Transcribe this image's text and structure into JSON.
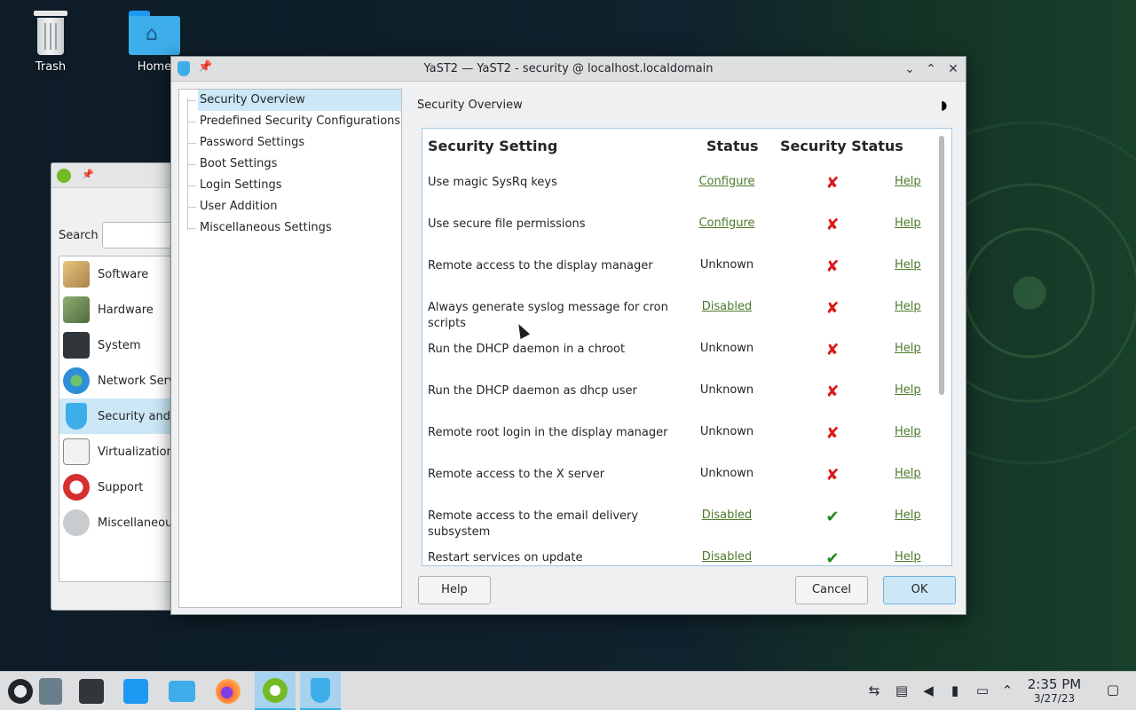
{
  "desktop": {
    "icons": [
      {
        "label": "Trash"
      },
      {
        "label": "Home"
      }
    ]
  },
  "back_window": {
    "search_label": "Search",
    "categories": [
      {
        "label": "Software",
        "color": "#c9a764"
      },
      {
        "label": "Hardware",
        "color": "#6f8a5a"
      },
      {
        "label": "System",
        "color": "#31363b"
      },
      {
        "label": "Network Serv",
        "color": "#2e8fd6"
      },
      {
        "label": "Security and U",
        "color": "#3daee9"
      },
      {
        "label": "Virtualization",
        "color": "#e8e8e8"
      },
      {
        "label": "Support",
        "color": "#d62f2f"
      },
      {
        "label": "Miscellaneous",
        "color": "#c9cccf"
      }
    ]
  },
  "window": {
    "title": "YaST2 — YaST2 - security @ localhost.localdomain",
    "tree": [
      {
        "label": "Security Overview"
      },
      {
        "label": "Predefined Security Configurations"
      },
      {
        "label": "Password Settings"
      },
      {
        "label": "Boot Settings"
      },
      {
        "label": "Login Settings"
      },
      {
        "label": "User Addition"
      },
      {
        "label": "Miscellaneous Settings"
      }
    ],
    "section_title": "Security Overview",
    "table": {
      "headers": {
        "setting": "Security Setting",
        "status": "Status",
        "security_status": "Security Status"
      },
      "rows": [
        {
          "setting": "Use magic SysRq keys",
          "status": "Configure",
          "status_link": true,
          "secure": false,
          "help": "Help"
        },
        {
          "setting": "Use secure file permissions",
          "status": "Configure",
          "status_link": true,
          "secure": false,
          "help": "Help"
        },
        {
          "setting": "Remote access to the display manager",
          "status": "Unknown",
          "status_link": false,
          "secure": false,
          "help": "Help"
        },
        {
          "setting": "Always generate syslog message for cron scripts",
          "status": "Disabled",
          "status_link": true,
          "secure": false,
          "help": "Help"
        },
        {
          "setting": "Run the DHCP daemon in a chroot",
          "status": "Unknown",
          "status_link": false,
          "secure": false,
          "help": "Help"
        },
        {
          "setting": "Run the DHCP daemon as dhcp user",
          "status": "Unknown",
          "status_link": false,
          "secure": false,
          "help": "Help"
        },
        {
          "setting": "Remote root login in the display manager",
          "status": "Unknown",
          "status_link": false,
          "secure": false,
          "help": "Help"
        },
        {
          "setting": "Remote access to the X server",
          "status": "Unknown",
          "status_link": false,
          "secure": false,
          "help": "Help"
        },
        {
          "setting": "Remote access to the email delivery subsystem",
          "status": "Disabled",
          "status_link": true,
          "secure": true,
          "help": "Help"
        },
        {
          "setting": "Restart services on update",
          "status": "Disabled",
          "status_link": true,
          "secure": true,
          "help": "Help"
        }
      ],
      "bad_glyph": "✘",
      "good_glyph": "✔"
    },
    "buttons": {
      "help": "Help",
      "cancel": "Cancel",
      "ok": "OK"
    }
  },
  "taskbar": {
    "clock_time": "2:35 PM",
    "clock_date": "3/27/23"
  },
  "colors": {
    "accent": "#3daee9",
    "link": "#4d7a2a",
    "bad": "#da1a1a",
    "good": "#1f8a1f"
  }
}
